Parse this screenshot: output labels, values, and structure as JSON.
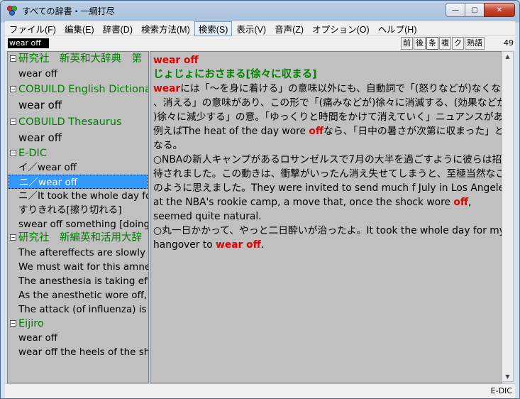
{
  "window": {
    "title": "すべての辞書・一綱打尽",
    "buttons": {
      "minimize": "—",
      "maximize": "▢",
      "close": "✕"
    }
  },
  "menu": [
    {
      "label": "ファイル(F)"
    },
    {
      "label": "編集(E)"
    },
    {
      "label": "辞書(D)"
    },
    {
      "label": "検索方法(M)"
    },
    {
      "label": "検索(S)"
    },
    {
      "label": "表示(V)"
    },
    {
      "label": "音声(Z)"
    },
    {
      "label": "オプション(O)"
    },
    {
      "label": "ヘルプ(H)"
    }
  ],
  "search": {
    "value": "wear off"
  },
  "mode_buttons": [
    "前",
    "後",
    "条",
    "複",
    "ク",
    "熟語"
  ],
  "result_count": "49",
  "tree": {
    "d1": "研究社　新英和大辞典　第",
    "d1_e1": "wear off",
    "d2": "COBUILD English Dictiona",
    "d2_e1": "wear off",
    "d3": "COBUILD Thesaurus",
    "d3_e1": "wear off",
    "d4": "E-DIC",
    "d4_e1": "イ／wear off",
    "d4_e2": "ニ／wear off",
    "d4_e3": "ニ／It took the whole day fo",
    "d4_e4": "すりきれる[擦り切れる]",
    "d4_e5": "swear off something [doing]",
    "d5": "研究社　新編英和活用大辞",
    "d5_e1": "The aftereffects are slowly",
    "d5_e2": "We must wait for this amne",
    "d5_e3": "The anesthesia is taking eff",
    "d5_e4": "As the anesthetic wore off,",
    "d5_e5": "The attack (of influenza) is",
    "d6": "Eijiro",
    "d6_e1": "wear off",
    "d6_e2": "wear off the heels of the sh"
  },
  "content": {
    "headword": "wear off",
    "reading": "じょじょにおさまる[徐々に収まる]",
    "l1a": "wear",
    "l1b": "には「～を身に着ける」の意味以外にも、自動詞で「(怒りなどが)なくなる",
    "l2": "、消える」の意味があり、この形で「(痛みなどが)徐々に消滅する、(効果などが",
    "l3": ")徐々に減少する」の意。「ゆっくりと時間をかけて消えていく」ニュアンスがあり、",
    "l4a": "例えばThe heat of the day wore ",
    "l4b": "off",
    "l4c": "なら、「日中の暑さが次第に収まった」と",
    "l5": "なる。",
    "l6": "○NBAの新人キャンプがあるロサンゼルスで7月の大半を過ごすように彼らは招",
    "l7": "待されました。この動きは、衝撃がいったん消え失せてしまうと、至極当然なこと",
    "l8": "のように思えました。They were invited to send much f July in Los Angeles",
    "l9a": "at the NBA's rookie camp, a move that, once the shock wore ",
    "l9b": "off",
    "l9c": ",",
    "l10": "seemed quite natural.",
    "l11": "○丸一日かかって、やっと二日酔いが治ったよ。It took the whole day for my",
    "l12a": "hangover to ",
    "l12b": "wear off",
    "l12c": "."
  },
  "status": {
    "dictionary": "E-DIC"
  }
}
